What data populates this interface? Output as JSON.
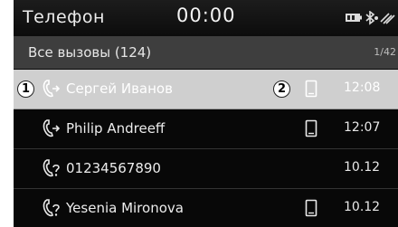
{
  "header": {
    "app_title": "Телефон",
    "clock": "00:00"
  },
  "list_header": {
    "title": "Все вызовы (124)",
    "page_indicator": "1/42"
  },
  "calls": [
    {
      "name": "Сергей Иванов",
      "time": "12:08",
      "call_icon": "outgoing-call-icon",
      "device_icon": "mobile-phone-icon",
      "selected": true,
      "callout_left": "1",
      "callout_right": "2"
    },
    {
      "name": "Philip Andreeff",
      "time": "12:07",
      "call_icon": "outgoing-call-icon",
      "device_icon": "mobile-phone-icon",
      "selected": false
    },
    {
      "name": "01234567890",
      "time": "10.12",
      "call_icon": "missed-call-icon",
      "device_icon": "",
      "selected": false
    },
    {
      "name": "Yesenia Mironova",
      "time": "10.12",
      "call_icon": "missed-call-icon",
      "device_icon": "mobile-phone-icon",
      "selected": false
    }
  ],
  "status_icons": [
    "battery-icon",
    "bluetooth-icon",
    "signal-icon"
  ],
  "colors": {
    "background": "#080808",
    "header_bar": "#3e3e3e",
    "selected_row": "#cfcfcf",
    "text": "#ececec"
  }
}
